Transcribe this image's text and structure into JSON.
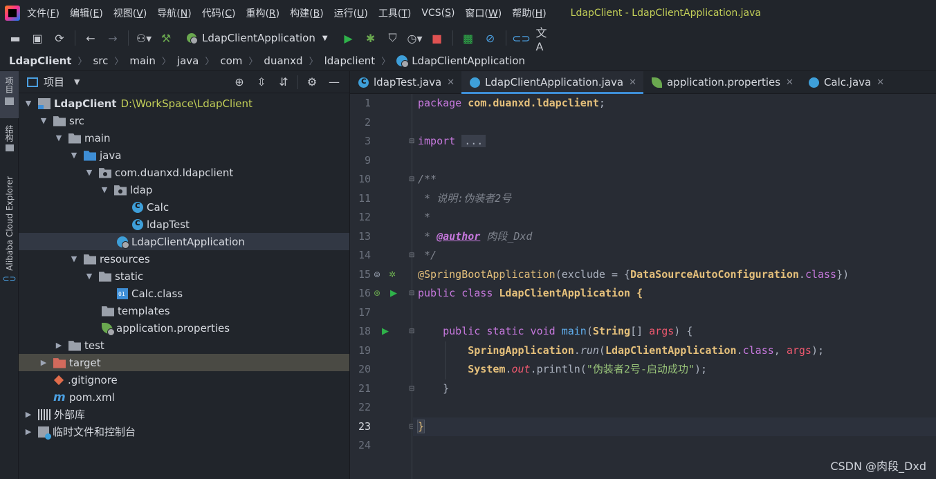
{
  "menubar": {
    "items": [
      {
        "label": "文件(",
        "key": "F",
        "end": ")"
      },
      {
        "label": "编辑(",
        "key": "E",
        "end": ")"
      },
      {
        "label": "视图(",
        "key": "V",
        "end": ")"
      },
      {
        "label": "导航(",
        "key": "N",
        "end": ")"
      },
      {
        "label": "代码(",
        "key": "C",
        "end": ")"
      },
      {
        "label": "重构(",
        "key": "R",
        "end": ")"
      },
      {
        "label": "构建(",
        "key": "B",
        "end": ")"
      },
      {
        "label": "运行(",
        "key": "U",
        "end": ")"
      },
      {
        "label": "工具(",
        "key": "T",
        "end": ")"
      },
      {
        "label": "VCS(",
        "key": "S",
        "end": ")"
      },
      {
        "label": "窗口(",
        "key": "W",
        "end": ")"
      },
      {
        "label": "帮助(",
        "key": "H",
        "end": ")"
      }
    ],
    "window_title": "LdapClient - LdapClientApplication.java"
  },
  "toolbar": {
    "run_config": "LdapClientApplication"
  },
  "breadcrumb": [
    "LdapClient",
    "src",
    "main",
    "java",
    "com",
    "duanxd",
    "ldapclient",
    "LdapClientApplication"
  ],
  "left_strip": {
    "project": "项目",
    "structure": "结构",
    "alibaba": "Alibaba Cloud Explorer"
  },
  "project_panel": {
    "title": "项目",
    "tree": [
      {
        "label": "LdapClient",
        "extra": "D:\\WorkSpace\\LdapClient"
      },
      {
        "label": "src"
      },
      {
        "label": "main"
      },
      {
        "label": "java"
      },
      {
        "label": "com.duanxd.ldapclient"
      },
      {
        "label": "ldap"
      },
      {
        "label": "Calc"
      },
      {
        "label": "ldapTest"
      },
      {
        "label": "LdapClientApplication"
      },
      {
        "label": "resources"
      },
      {
        "label": "static"
      },
      {
        "label": "Calc.class"
      },
      {
        "label": "templates"
      },
      {
        "label": "application.properties"
      },
      {
        "label": "test"
      },
      {
        "label": "target"
      },
      {
        "label": ".gitignore"
      },
      {
        "label": "pom.xml"
      },
      {
        "label": "外部库"
      },
      {
        "label": "临时文件和控制台"
      }
    ]
  },
  "tabs": [
    {
      "label": "ldapTest.java"
    },
    {
      "label": "LdapClientApplication.java"
    },
    {
      "label": "application.properties"
    },
    {
      "label": "Calc.java"
    }
  ],
  "editor": {
    "line_numbers": [
      "1",
      "2",
      "3",
      "9",
      "10",
      "11",
      "12",
      "13",
      "14",
      "15",
      "16",
      "17",
      "18",
      "19",
      "20",
      "21",
      "22",
      "23",
      "24"
    ],
    "code": {
      "l1_kw": "package",
      "l1_pkg": "com.duanxd.ldapclient",
      "l1_semi": ";",
      "l3_kw": "import",
      "l3_dots": "...",
      "l10": "/**",
      "l11": " * 说明:伪装者2号",
      "l12": " *",
      "l13_pre": " * ",
      "l13_tag": "@author",
      "l13_post": " 肉段_Dxd",
      "l14": " */",
      "l15_ann": "@SpringBootApplication",
      "l15_mid": "(exclude = {",
      "l15_type": "DataSourceAutoConfiguration",
      "l15_dot": ".",
      "l15_kw": "class",
      "l15_end": "})",
      "l16_kw": "public class ",
      "l16_type": "LdapClientApplication",
      "l16_brace": "{",
      "l18_indent": "    ",
      "l18_kw": "public static void ",
      "l18_fn": "main",
      "l18_open": "(",
      "l18_type": "String",
      "l18_arr": "[] ",
      "l18_param": "args",
      "l18_close": ") {",
      "l19_indent": "        ",
      "l19_type": "SpringApplication",
      "l19_dot": ".",
      "l19_fn": "run",
      "l19_open": "(",
      "l19_type2": "LdapClientApplication",
      "l19_dot2": ".",
      "l19_kw": "class",
      "l19_comma": ", ",
      "l19_param": "args",
      "l19_end": ");",
      "l20_indent": "        ",
      "l20_type": "System",
      "l20_dot": ".",
      "l20_field": "out",
      "l20_call": ".println(",
      "l20_str": "\"伪装者2号-启动成功\"",
      "l20_end": ");",
      "l21": "    }",
      "l23": "}"
    }
  },
  "watermark": "CSDN @肉段_Dxd",
  "colors": {
    "accent": "#3e8ed6",
    "title_text": "#c3cf58",
    "editor_bg": "#282c34",
    "panel_bg": "#21252b"
  }
}
